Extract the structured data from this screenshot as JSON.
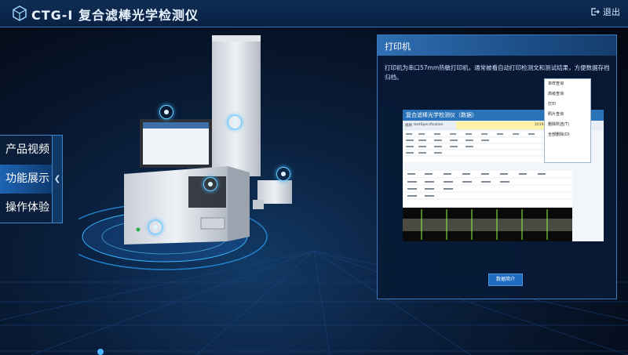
{
  "app": {
    "title": "CTG-I 复合滤棒光学检测仪",
    "exit_label": "退出"
  },
  "sidemenu": {
    "items": [
      {
        "label": "产品视频"
      },
      {
        "label": "功能展示"
      },
      {
        "label": "操作体验"
      }
    ],
    "active_index": 1
  },
  "panel": {
    "title": "打印机",
    "description": "打印机为串口57mm热敏打印机，通常被看自动打印检测文和测试结果，方便数据存档归档。",
    "screenshot": {
      "title": "复合滤棒光学检测仪（数据）",
      "spec_label": "规格",
      "spec_value": "testSpecification",
      "date": "2019-06-12",
      "context_menu": [
        "单样查询",
        "高级查询",
        "打印",
        "照片查询",
        "删除所选(T)",
        "全部删除(D)"
      ]
    },
    "button_label": "数据简介"
  }
}
